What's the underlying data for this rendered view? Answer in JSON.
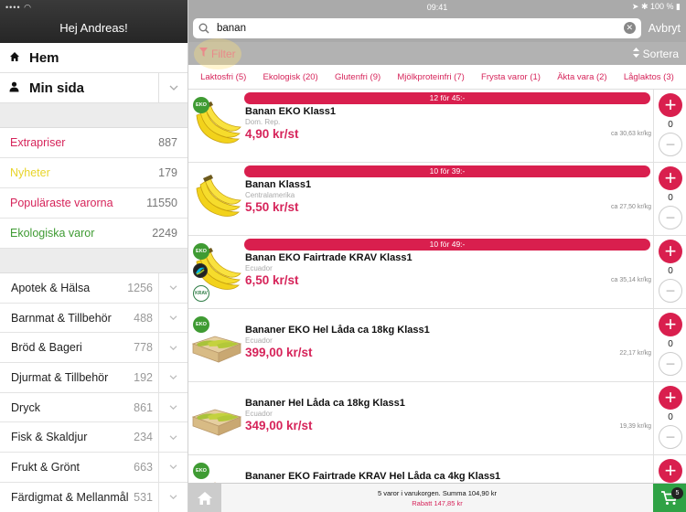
{
  "status": {
    "time": "09:41",
    "battery": "100 %"
  },
  "sidebar": {
    "greeting": "Hej Andreas!",
    "nav": [
      {
        "label": "Hem"
      },
      {
        "label": "Min sida"
      }
    ],
    "promos": [
      {
        "label": "Extrapriser",
        "count": "887",
        "color": "#d6245a"
      },
      {
        "label": "Nyheter",
        "count": "179",
        "color": "#e8d42a"
      },
      {
        "label": "Populäraste varorna",
        "count": "11550",
        "color": "#d6245a"
      },
      {
        "label": "Ekologiska varor",
        "count": "2249",
        "color": "#3f9b33"
      }
    ],
    "categories": [
      {
        "label": "Apotek & Hälsa",
        "count": "1256"
      },
      {
        "label": "Barnmat & Tillbehör",
        "count": "488"
      },
      {
        "label": "Bröd & Bageri",
        "count": "778"
      },
      {
        "label": "Djurmat & Tillbehör",
        "count": "192"
      },
      {
        "label": "Dryck",
        "count": "861"
      },
      {
        "label": "Fisk & Skaldjur",
        "count": "234"
      },
      {
        "label": "Frukt & Grönt",
        "count": "663"
      },
      {
        "label": "Färdigmat & Mellanmål",
        "count": "531"
      }
    ]
  },
  "search": {
    "value": "banan",
    "cancel_label": "Avbryt"
  },
  "toolbar": {
    "filter_label": "Filter",
    "sort_label": "Sortera"
  },
  "chips": [
    "Laktosfri (5)",
    "Ekologisk (20)",
    "Glutenfri (9)",
    "Mjölkproteinfri (7)",
    "Frysta varor (1)",
    "Äkta vara (2)",
    "Låglaktos (3)"
  ],
  "products": [
    {
      "deal": "12 för 45:-",
      "name": "Banan EKO Klass1",
      "origin": "Dom. Rep.",
      "price": "4,90 kr/st",
      "compare": "ca 30,63 kr/kg",
      "qty": "0",
      "eko": true,
      "fairtrade": false,
      "krav": false,
      "image": "bananas"
    },
    {
      "deal": "10 för 39:-",
      "name": "Banan Klass1",
      "origin": "Centralamerika",
      "price": "5,50 kr/st",
      "compare": "ca 27,50 kr/kg",
      "qty": "0",
      "eko": false,
      "fairtrade": false,
      "krav": false,
      "image": "bananas"
    },
    {
      "deal": "10 för 49:-",
      "name": "Banan EKO Fairtrade KRAV Klass1",
      "origin": "Ecuador",
      "price": "6,50 kr/st",
      "compare": "ca 35,14 kr/kg",
      "qty": "0",
      "eko": true,
      "fairtrade": true,
      "krav": true,
      "image": "bananas"
    },
    {
      "deal": "",
      "name": "Bananer EKO Hel Låda ca 18kg Klass1",
      "origin": "Ecuador",
      "price": "399,00 kr/st",
      "compare": "22,17 kr/kg",
      "qty": "0",
      "eko": true,
      "fairtrade": false,
      "krav": false,
      "image": "box"
    },
    {
      "deal": "",
      "name": "Bananer Hel Låda ca 18kg Klass1",
      "origin": "Ecuador",
      "price": "349,00 kr/st",
      "compare": "19,39 kr/kg",
      "qty": "0",
      "eko": false,
      "fairtrade": false,
      "krav": false,
      "image": "box"
    },
    {
      "deal": "",
      "name": "Bananer EKO Fairtrade KRAV Hel Låda ca 4kg Klass1",
      "origin": "",
      "price": "",
      "compare": "",
      "qty": "",
      "eko": true,
      "fairtrade": false,
      "krav": false,
      "image": "box"
    }
  ],
  "cart": {
    "summary": "5 varor i varukorgen. Summa 104,90 kr",
    "discount": "Rabatt 147,85 kr",
    "count": "5"
  },
  "badges": {
    "eko": "EKO",
    "krav": "KRAV"
  },
  "colors": {
    "accent": "#d91f4e",
    "eko_green": "#3f9b33",
    "cart_green": "#2fa245"
  }
}
